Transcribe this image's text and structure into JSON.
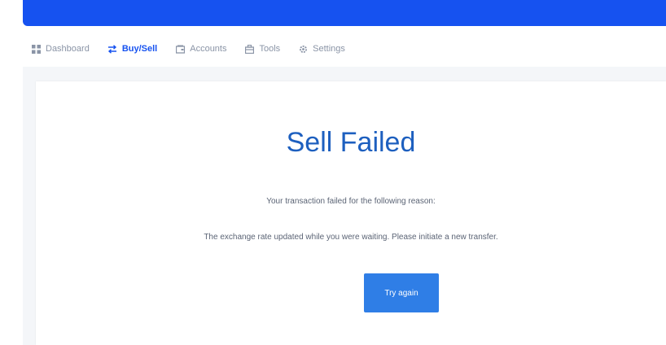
{
  "topbar": {
    "title": "",
    "color": "#1652f0"
  },
  "nav": {
    "items": [
      {
        "label": "Dashboard",
        "icon": "grid-icon",
        "active": false
      },
      {
        "label": "Buy/Sell",
        "icon": "swap-arrows-icon",
        "active": true
      },
      {
        "label": "Accounts",
        "icon": "wallet-icon",
        "active": false
      },
      {
        "label": "Tools",
        "icon": "toolbox-icon",
        "active": false
      },
      {
        "label": "Settings",
        "icon": "gear-icon",
        "active": false
      }
    ]
  },
  "main": {
    "title": "Sell Failed",
    "reason_intro": "Your transaction failed for the following reason:",
    "reason": "The exchange rate updated while you were waiting. Please initiate a new transfer.",
    "retry_label": "Try again"
  },
  "colors": {
    "accent": "#1652f0",
    "title": "#1d5fbf",
    "button": "#2f7ee6"
  }
}
